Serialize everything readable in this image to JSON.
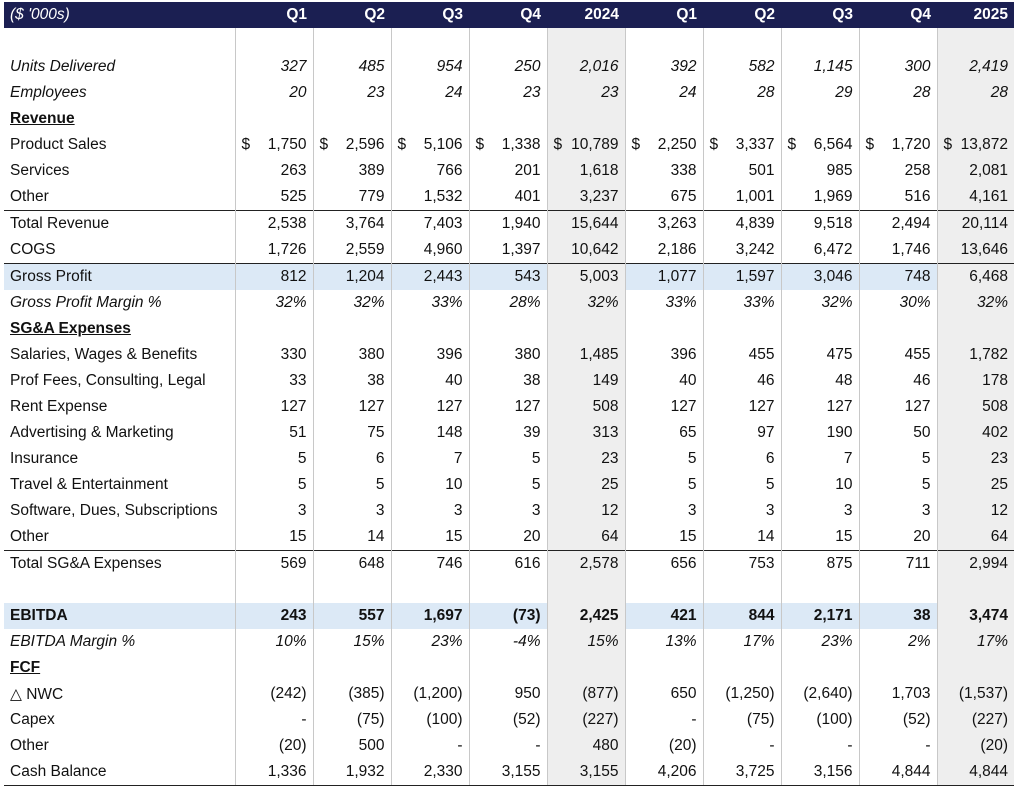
{
  "table": {
    "corner_label": "($ '000s)",
    "columns": [
      "Q1",
      "Q2",
      "Q3",
      "Q4",
      "2024",
      "Q1",
      "Q2",
      "Q3",
      "Q4",
      "2025"
    ],
    "total_column_indexes": [
      4,
      9
    ],
    "rows": [
      {
        "kind": "blank"
      },
      {
        "kind": "data",
        "style": "italic",
        "label": "Units Delivered",
        "values": [
          "327",
          "485",
          "954",
          "250",
          "2,016",
          "392",
          "582",
          "1,145",
          "300",
          "2,419"
        ]
      },
      {
        "kind": "data",
        "style": "italic",
        "label": "Employees",
        "values": [
          "20",
          "23",
          "24",
          "23",
          "23",
          "24",
          "28",
          "29",
          "28",
          "28"
        ]
      },
      {
        "kind": "header",
        "label": "Revenue"
      },
      {
        "kind": "data",
        "label": "Product Sales",
        "currency": "$",
        "values": [
          "1,750",
          "2,596",
          "5,106",
          "1,338",
          "10,789",
          "2,250",
          "3,337",
          "6,564",
          "1,720",
          "13,872"
        ]
      },
      {
        "kind": "data",
        "label": "Services",
        "values": [
          "263",
          "389",
          "766",
          "201",
          "1,618",
          "338",
          "501",
          "985",
          "258",
          "2,081"
        ]
      },
      {
        "kind": "data",
        "label": "Other",
        "values": [
          "525",
          "779",
          "1,532",
          "401",
          "3,237",
          "675",
          "1,001",
          "1,969",
          "516",
          "4,161"
        ]
      },
      {
        "kind": "data",
        "style": "indent topline",
        "label": "Total Revenue",
        "values": [
          "2,538",
          "3,764",
          "7,403",
          "1,940",
          "15,644",
          "3,263",
          "4,839",
          "9,518",
          "2,494",
          "20,114"
        ]
      },
      {
        "kind": "data",
        "label": "COGS",
        "values": [
          "1,726",
          "2,559",
          "4,960",
          "1,397",
          "10,642",
          "2,186",
          "3,242",
          "6,472",
          "1,746",
          "13,646"
        ]
      },
      {
        "kind": "data",
        "style": "indent hl topline",
        "label": "Gross Profit",
        "values": [
          "812",
          "1,204",
          "2,443",
          "543",
          "5,003",
          "1,077",
          "1,597",
          "3,046",
          "748",
          "6,468"
        ]
      },
      {
        "kind": "data",
        "style": "indent italic",
        "label": "Gross Profit Margin %",
        "values": [
          "32%",
          "32%",
          "33%",
          "28%",
          "32%",
          "33%",
          "33%",
          "32%",
          "30%",
          "32%"
        ]
      },
      {
        "kind": "header",
        "label": "SG&A Expenses"
      },
      {
        "kind": "data",
        "label": "Salaries, Wages & Benefits",
        "values": [
          "330",
          "380",
          "396",
          "380",
          "1,485",
          "396",
          "455",
          "475",
          "455",
          "1,782"
        ]
      },
      {
        "kind": "data",
        "label": "Prof Fees, Consulting, Legal",
        "values": [
          "33",
          "38",
          "40",
          "38",
          "149",
          "40",
          "46",
          "48",
          "46",
          "178"
        ]
      },
      {
        "kind": "data",
        "label": "Rent Expense",
        "values": [
          "127",
          "127",
          "127",
          "127",
          "508",
          "127",
          "127",
          "127",
          "127",
          "508"
        ]
      },
      {
        "kind": "data",
        "label": "Advertising & Marketing",
        "values": [
          "51",
          "75",
          "148",
          "39",
          "313",
          "65",
          "97",
          "190",
          "50",
          "402"
        ]
      },
      {
        "kind": "data",
        "label": "Insurance",
        "values": [
          "5",
          "6",
          "7",
          "5",
          "23",
          "5",
          "6",
          "7",
          "5",
          "23"
        ]
      },
      {
        "kind": "data",
        "label": "Travel & Entertainment",
        "values": [
          "5",
          "5",
          "10",
          "5",
          "25",
          "5",
          "5",
          "10",
          "5",
          "25"
        ]
      },
      {
        "kind": "data",
        "label": "Software, Dues, Subscriptions",
        "values": [
          "3",
          "3",
          "3",
          "3",
          "12",
          "3",
          "3",
          "3",
          "3",
          "12"
        ]
      },
      {
        "kind": "data",
        "label": "Other",
        "values": [
          "15",
          "14",
          "15",
          "20",
          "64",
          "15",
          "14",
          "15",
          "20",
          "64"
        ]
      },
      {
        "kind": "data",
        "style": "indent topline",
        "label": "Total SG&A Expenses",
        "values": [
          "569",
          "648",
          "746",
          "616",
          "2,578",
          "656",
          "753",
          "875",
          "711",
          "2,994"
        ]
      },
      {
        "kind": "half"
      },
      {
        "kind": "data",
        "style": "bold hl",
        "label": "EBITDA",
        "values": [
          "243",
          "557",
          "1,697",
          "(73)",
          "2,425",
          "421",
          "844",
          "2,171",
          "38",
          "3,474"
        ]
      },
      {
        "kind": "data",
        "style": "indent italic",
        "label": "EBITDA Margin %",
        "values": [
          "10%",
          "15%",
          "23%",
          "-4%",
          "15%",
          "13%",
          "17%",
          "23%",
          "2%",
          "17%"
        ]
      },
      {
        "kind": "header",
        "label": "FCF"
      },
      {
        "kind": "data",
        "label": "△ NWC",
        "values": [
          "(242)",
          "(385)",
          "(1,200)",
          "950",
          "(877)",
          "650",
          "(1,250)",
          "(2,640)",
          "1,703",
          "(1,537)"
        ]
      },
      {
        "kind": "data",
        "label": "Capex",
        "values": [
          "-",
          "(75)",
          "(100)",
          "(52)",
          "(227)",
          "-",
          "(75)",
          "(100)",
          "(52)",
          "(227)"
        ]
      },
      {
        "kind": "data",
        "label": "Other",
        "values": [
          "(20)",
          "500",
          "-",
          "-",
          "480",
          "(20)",
          "-",
          "-",
          "-",
          "(20)"
        ]
      },
      {
        "kind": "data",
        "style": "botline",
        "label": "Cash Balance",
        "values": [
          "1,336",
          "1,932",
          "2,330",
          "3,155",
          "3,155",
          "4,206",
          "3,725",
          "3,156",
          "4,844",
          "4,844"
        ]
      }
    ]
  },
  "colors": {
    "header_bg": "#1b1f52",
    "highlight_row": "#dce9f6",
    "total_column": "#eeeeee"
  }
}
